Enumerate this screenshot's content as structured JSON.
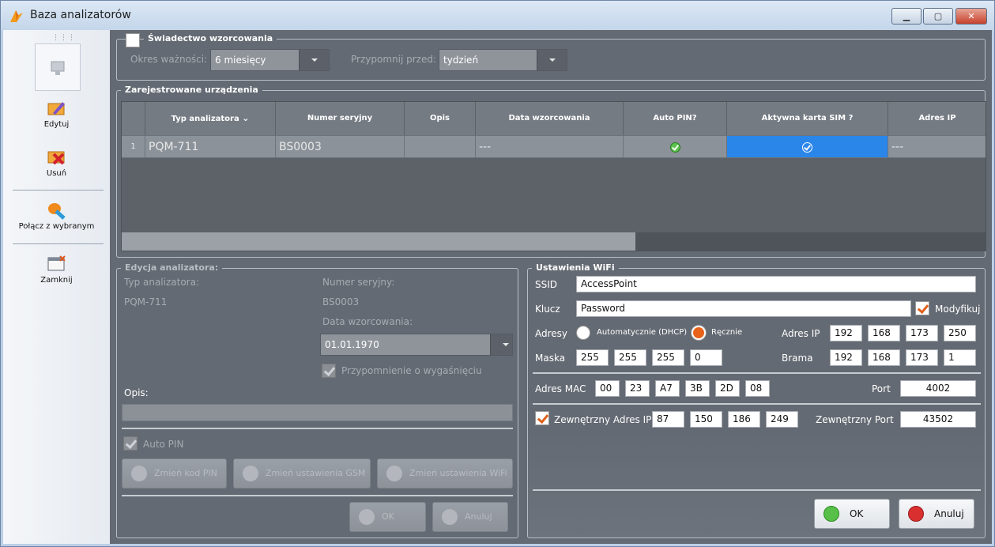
{
  "window": {
    "title": "Baza analizatorów",
    "minimize": "▁",
    "maximize": "▢",
    "close": "✕"
  },
  "sidebar": {
    "edit": "Edytuj",
    "delete": "Usuń",
    "connect": "Połącz z wybranym",
    "close": "Zamknij"
  },
  "calibration": {
    "title": "Świadectwo wzorcowania",
    "validity_label": "Okres ważności:",
    "validity_value": "6 miesięcy",
    "remind_label": "Przypomnij przed:",
    "remind_value": "tydzień"
  },
  "devices": {
    "title": "Zarejestrowane urządzenia",
    "columns": [
      "Typ analizatora",
      "Numer seryjny",
      "Opis",
      "Data wzorcowania",
      "Auto PIN?",
      "Aktywna karta SIM ?",
      "Adres IP"
    ],
    "rows": [
      {
        "index": "1",
        "type": "PQM-711",
        "serial": "BS0003",
        "desc": "",
        "calib_date": "---",
        "auto_pin": true,
        "sim_active": true,
        "ip": "---"
      }
    ],
    "horizontal_scroll_fraction": 0.6
  },
  "edit": {
    "title": "Edycja analizatora:",
    "type_label": "Typ analizatora:",
    "type_value": "PQM-711",
    "serial_label": "Numer seryjny:",
    "serial_value": "BS0003",
    "calib_label": "Data wzorcowania:",
    "calib_value": "01.01.1970",
    "reminder_label": "Przypomnienie o wygaśnięciu",
    "desc_label": "Opis:",
    "desc_value": "",
    "autopin_label": "Auto PIN",
    "btn_pin": "Zmień kod PIN",
    "btn_gsm": "Zmień ustawienia GSM",
    "btn_wifi": "Zmień ustawienia WiFi",
    "ok": "OK",
    "cancel": "Anuluj"
  },
  "wifi": {
    "title": "Ustawienia WiFi",
    "ssid_label": "SSID",
    "ssid": "AccessPoint",
    "key_label": "Klucz",
    "key": "Password",
    "modify_label": "Modyfikuj",
    "address_label": "Adresy",
    "dhcp_label": "Automatycznie (DHCP)",
    "manual_label": "Ręcznie",
    "ip_label": "Adres IP",
    "ip": [
      "192",
      "168",
      "173",
      "250"
    ],
    "mask_label": "Maska",
    "mask": [
      "255",
      "255",
      "255",
      "0"
    ],
    "gateway_label": "Brama",
    "gateway": [
      "192",
      "168",
      "173",
      "1"
    ],
    "mac_label": "Adres MAC",
    "mac": [
      "00",
      "23",
      "A7",
      "3B",
      "2D",
      "08"
    ],
    "port_label": "Port",
    "port": "4002",
    "ext_ip_label": "Zewnętrzny Adres IP",
    "ext_ip": [
      "87",
      "150",
      "186",
      "249"
    ],
    "ext_port_label": "Zewnętrzny Port",
    "ext_port": "43502",
    "ok": "OK",
    "cancel": "Anuluj"
  }
}
